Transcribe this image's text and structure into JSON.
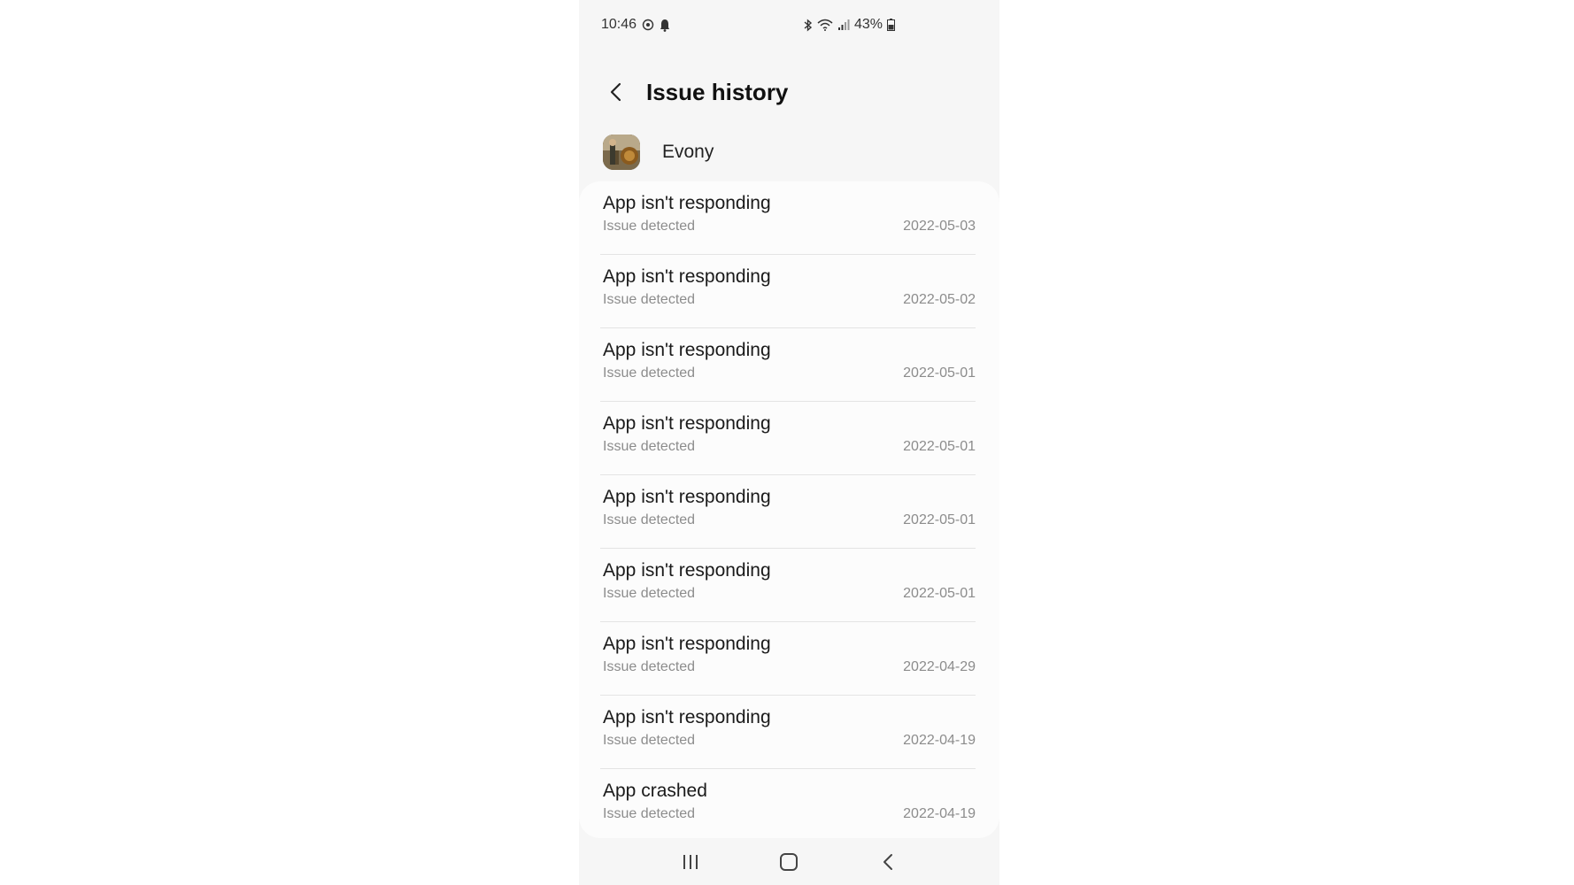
{
  "status_bar": {
    "time": "10:46",
    "battery": "43%",
    "left_icons": [
      "alarm-icon",
      "notification-icon"
    ],
    "right_icons": [
      "bluetooth-icon",
      "wifi-icon",
      "signal-icon",
      "battery-icon"
    ]
  },
  "header": {
    "back_icon": "back-arrow-icon",
    "title": "Issue history"
  },
  "app": {
    "name": "Evony",
    "icon": "app-icon"
  },
  "issues": [
    {
      "title": "App isn't responding",
      "subtitle": "Issue detected",
      "date": "2022-05-03"
    },
    {
      "title": "App isn't responding",
      "subtitle": "Issue detected",
      "date": "2022-05-02"
    },
    {
      "title": "App isn't responding",
      "subtitle": "Issue detected",
      "date": "2022-05-01"
    },
    {
      "title": "App isn't responding",
      "subtitle": "Issue detected",
      "date": "2022-05-01"
    },
    {
      "title": "App isn't responding",
      "subtitle": "Issue detected",
      "date": "2022-05-01"
    },
    {
      "title": "App isn't responding",
      "subtitle": "Issue detected",
      "date": "2022-05-01"
    },
    {
      "title": "App isn't responding",
      "subtitle": "Issue detected",
      "date": "2022-04-29"
    },
    {
      "title": "App isn't responding",
      "subtitle": "Issue detected",
      "date": "2022-04-19"
    },
    {
      "title": "App crashed",
      "subtitle": "Issue detected",
      "date": "2022-04-19"
    }
  ],
  "nav_bar": {
    "recents_icon": "recents-icon",
    "home_icon": "home-icon",
    "back_icon": "back-icon"
  },
  "colors": {
    "background": "#f6f6f6",
    "card": "#fcfcfc",
    "title_text": "#111111",
    "secondary_text": "#8c8c8c"
  }
}
